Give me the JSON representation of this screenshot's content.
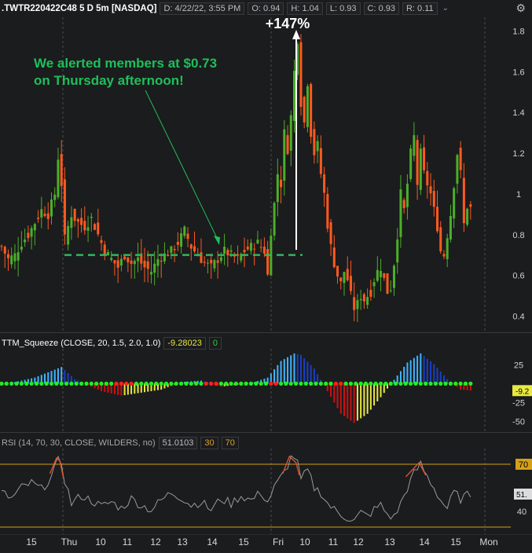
{
  "header": {
    "symbol": ".TWTR220422C48 5 D 5m [NASDAQ]",
    "date": "D: 4/22/22, 3:55 PM",
    "open": "O: 0.94",
    "high": "H: 1.04",
    "low": "L: 0.93",
    "close": "C: 0.93",
    "range": "R: 0.11"
  },
  "annotations": {
    "gain": "+147%",
    "alert_line1": "We alerted members at $0.73",
    "alert_line2": "on Thursday afternoon!"
  },
  "ttm": {
    "label": "TTM_Squeeze (CLOSE, 20, 1.5, 2.0, 1.0)",
    "value": "-9.28023",
    "signal": "0",
    "last_label": "-9.2"
  },
  "rsi": {
    "label": "RSI (14, 70, 30, CLOSE, WILDERS, no)",
    "value": "51.0103",
    "lower": "30",
    "upper": "70",
    "last_label": "51."
  },
  "colors": {
    "up": "#4caf28",
    "down": "#ff5a1f",
    "alert_line": "#2eb85c",
    "annotation": "#1fbf5a",
    "rsi_line": "#9a9a9a",
    "rsi_over": "#e8532a",
    "rsi_band": "#d4a017"
  },
  "chart_data": [
    {
      "type": "candlestick",
      "title": ".TWTR220422C48 5 D 5m [NASDAQ]",
      "y_ticks": [
        "1.8",
        "1.6",
        "1.4",
        "1.2",
        "1",
        "0.8",
        "0.6",
        "0.4"
      ],
      "ylim": [
        0.34,
        1.86
      ],
      "alert_level": 0.7,
      "x_ticks": [
        "15",
        "Thu",
        "10",
        "11",
        "12",
        "13",
        "14",
        "15",
        "Fri",
        "10",
        "11",
        "12",
        "13",
        "14",
        "15",
        "Mon"
      ],
      "sessions": [
        "Thu",
        "Fri"
      ],
      "close_path": [
        [
          0,
          0.74
        ],
        [
          2,
          0.68
        ],
        [
          4,
          0.7
        ],
        [
          6,
          0.76
        ],
        [
          8,
          0.8
        ],
        [
          10,
          0.86
        ],
        [
          12,
          0.92
        ],
        [
          14,
          0.9
        ],
        [
          16,
          1.0
        ],
        [
          17,
          1.18
        ],
        [
          18,
          1.05
        ],
        [
          19,
          0.78
        ],
        [
          21,
          0.9
        ],
        [
          23,
          0.86
        ],
        [
          25,
          0.84
        ],
        [
          27,
          0.88
        ],
        [
          29,
          0.8
        ],
        [
          31,
          0.72
        ],
        [
          33,
          0.68
        ],
        [
          35,
          0.64
        ],
        [
          37,
          0.7
        ],
        [
          39,
          0.66
        ],
        [
          41,
          0.68
        ],
        [
          43,
          0.64
        ],
        [
          45,
          0.62
        ],
        [
          47,
          0.68
        ],
        [
          49,
          0.7
        ],
        [
          51,
          0.72
        ],
        [
          53,
          0.76
        ],
        [
          55,
          0.82
        ],
        [
          57,
          0.74
        ],
        [
          59,
          0.7
        ],
        [
          61,
          0.66
        ],
        [
          63,
          0.64
        ],
        [
          65,
          0.68
        ],
        [
          67,
          0.72
        ],
        [
          69,
          0.7
        ],
        [
          71,
          0.68
        ],
        [
          73,
          0.72
        ],
        [
          75,
          0.74
        ],
        [
          77,
          0.76
        ],
        [
          79,
          0.72
        ],
        [
          80,
          0.6
        ],
        [
          81,
          0.82
        ],
        [
          82,
          0.95
        ],
        [
          83,
          1.1
        ],
        [
          84,
          1.05
        ],
        [
          85,
          1.3
        ],
        [
          86,
          1.22
        ],
        [
          87,
          1.38
        ],
        [
          88,
          1.6
        ],
        [
          89,
          1.76
        ],
        [
          90,
          1.45
        ],
        [
          91,
          1.35
        ],
        [
          92,
          1.55
        ],
        [
          93,
          1.3
        ],
        [
          94,
          1.2
        ],
        [
          95,
          1.24
        ],
        [
          96,
          1.1
        ],
        [
          97,
          1.0
        ],
        [
          98,
          0.85
        ],
        [
          99,
          0.74
        ],
        [
          100,
          0.66
        ],
        [
          101,
          0.6
        ],
        [
          102,
          0.56
        ],
        [
          103,
          0.62
        ],
        [
          104,
          0.58
        ],
        [
          105,
          0.5
        ],
        [
          106,
          0.44
        ],
        [
          107,
          0.46
        ],
        [
          108,
          0.5
        ],
        [
          109,
          0.48
        ],
        [
          110,
          0.5
        ],
        [
          111,
          0.52
        ],
        [
          112,
          0.58
        ],
        [
          113,
          0.62
        ],
        [
          114,
          0.64
        ],
        [
          115,
          0.58
        ],
        [
          116,
          0.52
        ],
        [
          117,
          0.54
        ],
        [
          118,
          0.66
        ],
        [
          119,
          0.8
        ],
        [
          120,
          1.0
        ],
        [
          121,
          0.92
        ],
        [
          122,
          1.05
        ],
        [
          123,
          1.2
        ],
        [
          124,
          1.28
        ],
        [
          125,
          1.05
        ],
        [
          126,
          1.2
        ],
        [
          127,
          1.1
        ],
        [
          128,
          1.05
        ],
        [
          129,
          1.0
        ],
        [
          130,
          0.92
        ],
        [
          131,
          0.84
        ],
        [
          132,
          0.72
        ],
        [
          133,
          0.7
        ],
        [
          134,
          0.8
        ],
        [
          135,
          0.9
        ],
        [
          136,
          1.05
        ],
        [
          137,
          1.2
        ],
        [
          138,
          1.1
        ],
        [
          139,
          0.85
        ],
        [
          140,
          0.94
        ],
        [
          141,
          0.93
        ]
      ]
    },
    {
      "type": "histogram",
      "title": "TTM_Squeeze (CLOSE, 20, 1.5, 2.0, 1.0)",
      "y_ticks": [
        "25",
        "-25",
        "-50"
      ],
      "ylim": [
        -60,
        42
      ],
      "series": [
        {
          "name": "momentum",
          "x": [
            0,
            10,
            18,
            22,
            26,
            30,
            36,
            42,
            48,
            54,
            60,
            66,
            70,
            76,
            80,
            84,
            88,
            90,
            94,
            98,
            102,
            106,
            110,
            114,
            118,
            122,
            126,
            130,
            134,
            138,
            141
          ],
          "values": [
            -2,
            8,
            22,
            6,
            -2,
            -10,
            -16,
            -12,
            -8,
            2,
            4,
            -4,
            -2,
            2,
            8,
            30,
            40,
            38,
            20,
            -10,
            -40,
            -52,
            -40,
            -18,
            5,
            28,
            40,
            26,
            6,
            -8,
            -9.3
          ]
        }
      ]
    },
    {
      "type": "line",
      "title": "RSI (14, 70, 30, CLOSE, WILDERS, no)",
      "y_ticks": [
        "70",
        "40"
      ],
      "ylim": [
        27,
        78
      ],
      "levels": [
        30,
        70
      ],
      "series": [
        {
          "name": "RSI",
          "x": [
            0,
            3,
            6,
            9,
            12,
            15,
            17,
            18,
            19,
            21,
            24,
            27,
            30,
            33,
            36,
            39,
            42,
            45,
            48,
            51,
            54,
            57,
            60,
            63,
            66,
            69,
            72,
            75,
            78,
            80,
            82,
            85,
            87,
            88,
            89,
            90,
            92,
            94,
            96,
            98,
            100,
            102,
            104,
            106,
            108,
            110,
            112,
            114,
            116,
            118,
            120,
            122,
            124,
            126,
            128,
            130,
            132,
            134,
            136,
            138,
            140,
            141
          ],
          "values": [
            52,
            48,
            55,
            58,
            54,
            62,
            72,
            71,
            60,
            45,
            50,
            47,
            43,
            46,
            42,
            48,
            44,
            41,
            47,
            52,
            49,
            44,
            46,
            41,
            48,
            45,
            50,
            47,
            52,
            46,
            55,
            65,
            74,
            75,
            70,
            60,
            66,
            55,
            52,
            45,
            41,
            38,
            36,
            34,
            39,
            37,
            41,
            44,
            38,
            36,
            45,
            55,
            64,
            70,
            62,
            55,
            47,
            42,
            52,
            48,
            50,
            51
          ]
        }
      ]
    }
  ]
}
